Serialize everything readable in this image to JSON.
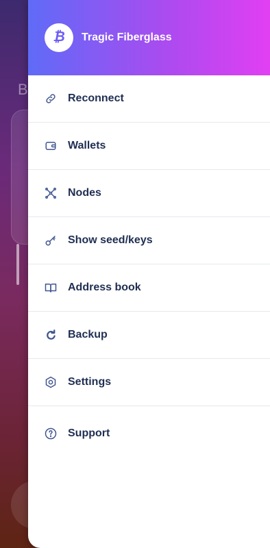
{
  "background": {
    "hidden_letter": "B"
  },
  "drawer": {
    "header": {
      "wallet_name": "Tragic Fiberglass",
      "avatar_icon": "bitcoin-icon"
    },
    "items": [
      {
        "label": "Reconnect",
        "icon": "link-icon"
      },
      {
        "label": "Wallets",
        "icon": "wallet-icon"
      },
      {
        "label": "Nodes",
        "icon": "nodes-icon"
      },
      {
        "label": "Show seed/keys",
        "icon": "key-icon"
      },
      {
        "label": "Address book",
        "icon": "book-icon"
      },
      {
        "label": "Backup",
        "icon": "backup-icon"
      },
      {
        "label": "Settings",
        "icon": "settings-icon"
      },
      {
        "label": "Support",
        "icon": "help-icon"
      }
    ]
  },
  "colors": {
    "header_gradient_start": "#5f6bf7",
    "header_gradient_end": "#e13ff2",
    "menu_text": "#1f2f52",
    "icon": "#3f5690",
    "divider": "#e6e8ee"
  }
}
